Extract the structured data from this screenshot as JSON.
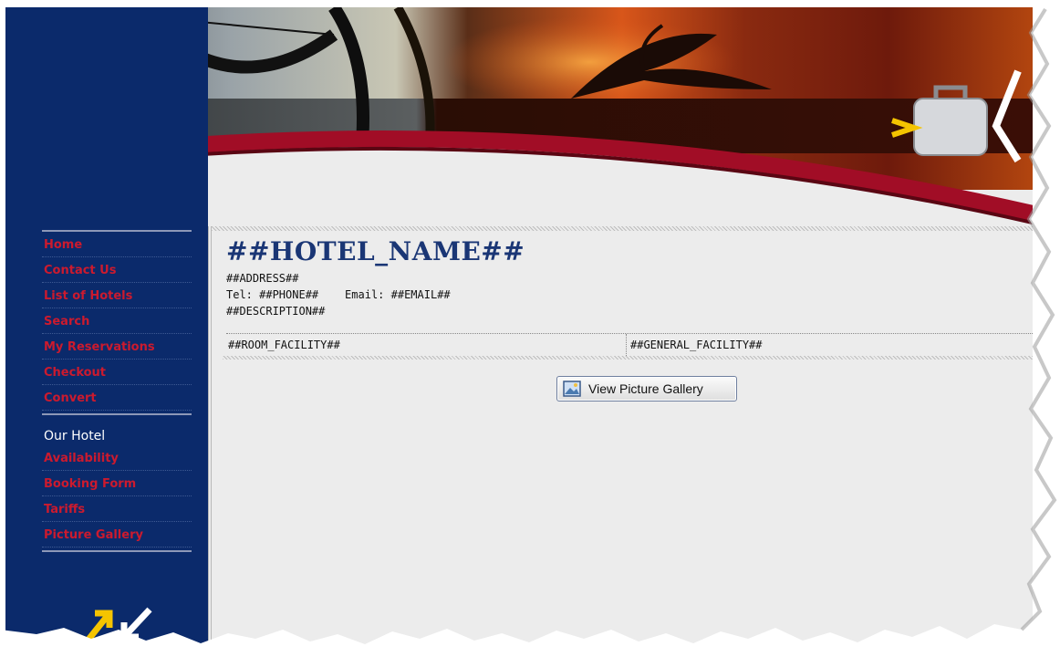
{
  "sidebar": {
    "nav": [
      {
        "label": "Home"
      },
      {
        "label": "Contact Us"
      },
      {
        "label": "List of Hotels"
      },
      {
        "label": "Search"
      },
      {
        "label": "My Reservations"
      },
      {
        "label": "Checkout"
      },
      {
        "label": "Convert"
      }
    ],
    "section_title": "Our Hotel",
    "hotel_nav": [
      {
        "label": "Availability"
      },
      {
        "label": "Booking Form"
      },
      {
        "label": "Tariffs"
      },
      {
        "label": "Picture Gallery"
      }
    ]
  },
  "hotel": {
    "name": "##HOTEL_NAME##",
    "address": "##ADDRESS##",
    "contact_line": "Tel: ##PHONE##    Email: ##EMAIL##",
    "description": "##DESCRIPTION##",
    "room_facility": "##ROOM_FACILITY##",
    "general_facility": "##GENERAL_FACILITY##"
  },
  "gallery_button": {
    "label": "View Picture Gallery"
  },
  "colors": {
    "sidebar_bg": "#0b2a6b",
    "nav_link": "#cc1a2e",
    "accent_red": "#b0102a",
    "hotel_name": "#1a3675",
    "page_bg": "#ececec"
  },
  "icons": [
    "globe-image",
    "hammock-image",
    "palm-sunset-image",
    "suitcase-icon",
    "arrows-logo-icon",
    "picture-icon"
  ]
}
